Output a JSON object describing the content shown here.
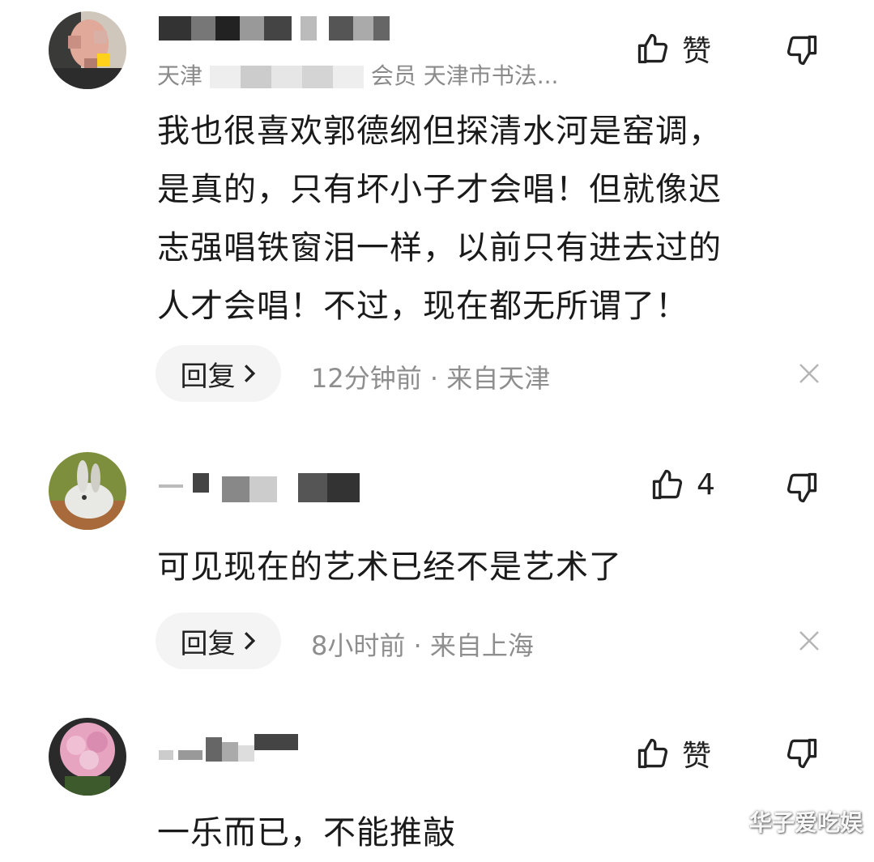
{
  "comments": [
    {
      "meta_prefix": "天津",
      "meta_suffix": "会员 天津市书法...",
      "like_label": "赞",
      "text": "我也很喜欢郭德纲但探清水河是窑调，\n是真的，只有坏小子才会唱！但就像迟\n志强唱铁窗泪一样，以前只有进去过的\n人才会唱！不过，现在都无所谓了！",
      "reply_label": "回复",
      "time": "12分钟前 · 来自天津"
    },
    {
      "like_label": "4",
      "text": "可见现在的艺术已经不是艺术了",
      "reply_label": "回复",
      "time": "8小时前 · 来自上海"
    },
    {
      "like_label": "赞",
      "text": "一乐而已，不能推敲"
    }
  ],
  "watermark": "华子爱吃娱",
  "icons": {
    "like": "thumbs-up-icon",
    "dislike": "thumbs-down-icon",
    "chevron": "chevron-right-icon",
    "close": "close-icon"
  }
}
